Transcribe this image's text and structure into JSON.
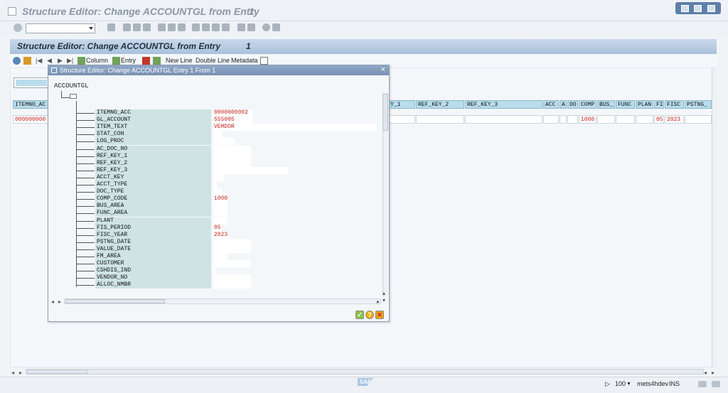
{
  "window": {
    "title": "Structure Editor: Change ACCOUNTGL from Entry",
    "entry_no": "1"
  },
  "screen": {
    "title": "Structure Editor: Change ACCOUNTGL from Entry",
    "entry_no": "1"
  },
  "app_toolbar": {
    "column": "Column",
    "entry": "Entry",
    "new_line": "New Line",
    "double_line": "Double Line",
    "metadata": "Metadata"
  },
  "background_table": {
    "columns": [
      "ITEMNO_AC",
      "Y_1",
      "REF_KEY_2",
      "REF_KEY_3",
      "ACC",
      "A",
      "DO",
      "COMP",
      "BUS_",
      "FUNC",
      "PLAN",
      "FI",
      "FISC",
      "PSTNG_"
    ],
    "row_values": [
      "000000000",
      "1000",
      "05",
      "2023"
    ]
  },
  "dialog": {
    "title": "Structure Editor: Change ACCOUNTGL Entry 1 From 1",
    "close": "×",
    "root": "ACCOUNTGL",
    "fields": [
      {
        "name": "ITEMNO_ACC",
        "value": "0000000002"
      },
      {
        "name": "GL_ACCOUNT",
        "value": "555005"
      },
      {
        "name": "ITEM_TEXT",
        "value": "VEMDOR"
      },
      {
        "name": "STAT_CON",
        "value": ""
      },
      {
        "name": "LOG_PROC",
        "value": ""
      },
      {
        "name": "AC_DOC_NO",
        "value": ""
      },
      {
        "name": "REF_KEY_1",
        "value": ""
      },
      {
        "name": "REF_KEY_2",
        "value": ""
      },
      {
        "name": "REF_KEY_3",
        "value": ""
      },
      {
        "name": "ACCT_KEY",
        "value": ""
      },
      {
        "name": "ACCT_TYPE",
        "value": ""
      },
      {
        "name": "DOC_TYPE",
        "value": ""
      },
      {
        "name": "COMP_CODE",
        "value": "1000"
      },
      {
        "name": "BUS_AREA",
        "value": ""
      },
      {
        "name": "FUNC_AREA",
        "value": ""
      },
      {
        "name": "PLANT",
        "value": ""
      },
      {
        "name": "FIS_PERIOD",
        "value": "05"
      },
      {
        "name": "FISC_YEAR",
        "value": "2023"
      },
      {
        "name": "PSTNG_DATE",
        "value": ""
      },
      {
        "name": "VALUE_DATE",
        "value": ""
      },
      {
        "name": "FM_AREA",
        "value": ""
      },
      {
        "name": "CUSTOMER",
        "value": ""
      },
      {
        "name": "CSHDIS_IND",
        "value": ""
      },
      {
        "name": "VENDOR_NO",
        "value": ""
      },
      {
        "name": "ALLOC_NMBR",
        "value": ""
      }
    ]
  },
  "status": {
    "zoom": "100",
    "system": "mets4hdev",
    "mode": "INS"
  },
  "colors": {
    "header_blue": "#a9c1dc",
    "dialog_title": "#7991b3",
    "field_label_bg": "#cfe3e3",
    "value_red": "#c0201a",
    "table_header": "#b9ddec"
  },
  "icons": [
    "enter-icon",
    "save-icon",
    "back-icon",
    "exit-icon",
    "cancel-icon",
    "print-icon",
    "find-icon",
    "first-page-icon",
    "prev-page-icon",
    "next-page-icon",
    "last-page-icon",
    "new-session-icon",
    "shortcut-icon",
    "help-icon",
    "layout-icon",
    "accept-icon",
    "help-dialog-icon",
    "cancel-dialog-icon",
    "sap-logo"
  ]
}
